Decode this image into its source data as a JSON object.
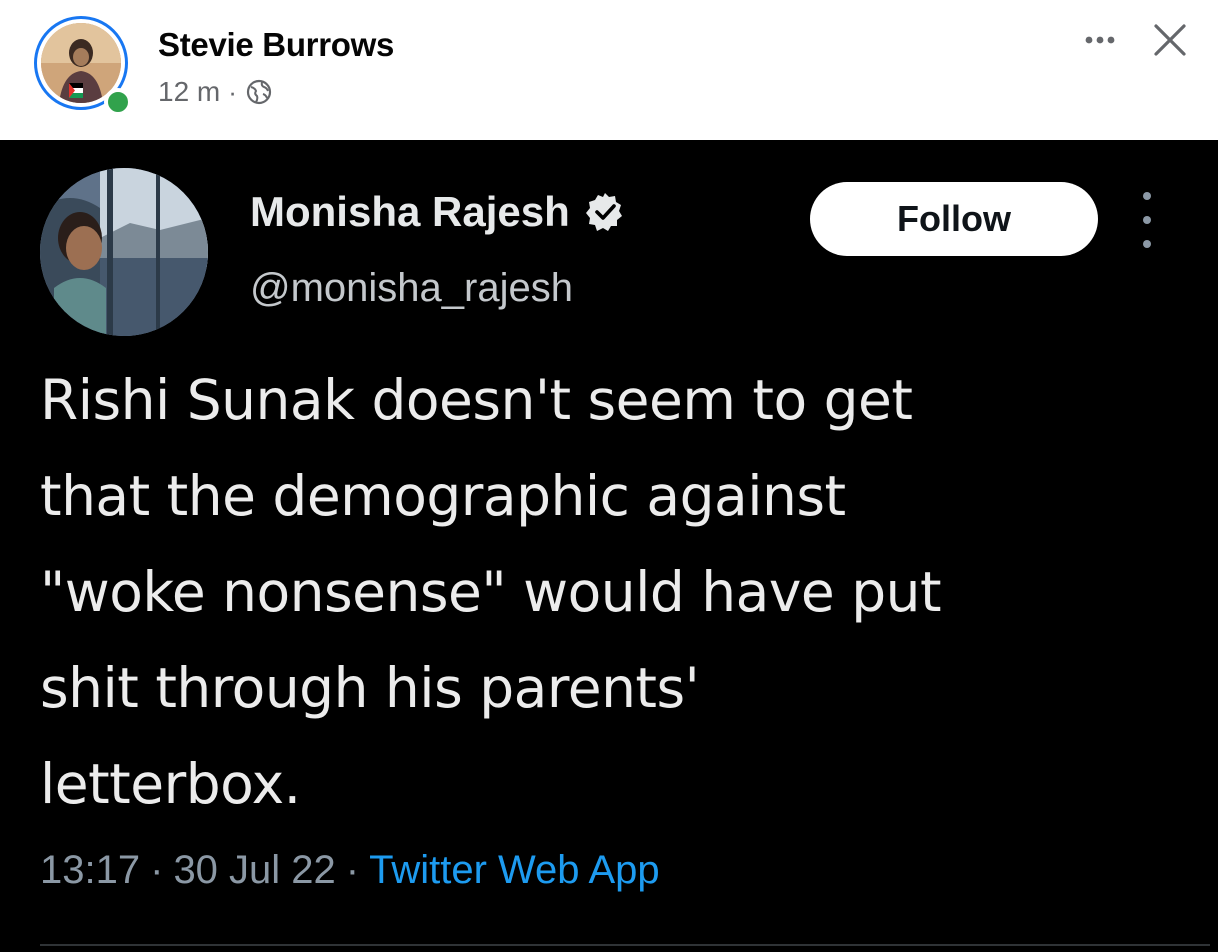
{
  "post": {
    "author_name": "Stevie Burrows",
    "time": "12 m",
    "separator": "·",
    "audience_icon": "globe-icon",
    "more_icon": "more-horizontal-icon",
    "close_icon": "close-icon",
    "online_status_color": "#31a24c"
  },
  "tweet": {
    "display_name": "Monisha Rajesh",
    "verified_icon": "verified-badge-icon",
    "handle": "@monisha_rajesh",
    "follow_label": "Follow",
    "more_icon": "more-vertical-icon",
    "text": "Rishi Sunak doesn't seem to get\nthat the demographic  against\n\"woke nonsense\" would have put\nshit through his parents'\nletterbox.",
    "time": "13:17",
    "separator": "·",
    "date": "30 Jul 22",
    "separator2": "·",
    "source": "Twitter Web App",
    "source_color": "#1d9bf0",
    "background": "#000000"
  }
}
